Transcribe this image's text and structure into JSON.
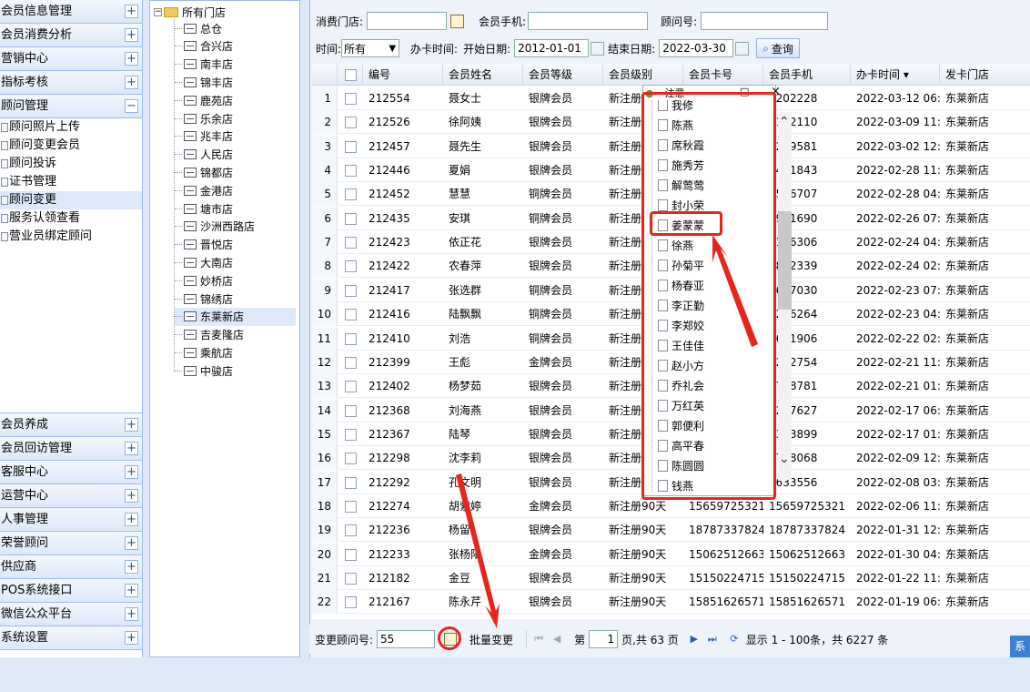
{
  "sidebar": {
    "top_groups": [
      {
        "label": "会员信息管理",
        "toggle": "+"
      },
      {
        "label": "会员消费分析",
        "toggle": "+"
      },
      {
        "label": "营销中心",
        "toggle": "+"
      },
      {
        "label": "指标考核",
        "toggle": "+"
      },
      {
        "label": "顾问管理",
        "toggle": "−"
      }
    ],
    "sub_items": [
      "顾问照片上传",
      "顾问变更会员",
      "顾问投诉",
      "证书管理",
      "顾问变更",
      "服务认领查看",
      "营业员绑定顾问"
    ],
    "selected_sub": "顾问变更",
    "bottom_groups": [
      {
        "label": "会员养成",
        "toggle": "+"
      },
      {
        "label": "会员回访管理",
        "toggle": "+"
      },
      {
        "label": "客服中心",
        "toggle": "+"
      },
      {
        "label": "运营中心",
        "toggle": "+"
      },
      {
        "label": "人事管理",
        "toggle": "+"
      },
      {
        "label": "荣誉顾问",
        "toggle": "+"
      },
      {
        "label": "供应商",
        "toggle": "+"
      },
      {
        "label": "POS系统接口",
        "toggle": "+"
      },
      {
        "label": "微信公众平台",
        "toggle": "+"
      },
      {
        "label": "系统设置",
        "toggle": "+"
      }
    ]
  },
  "store_tree": {
    "root": "所有门店",
    "stores": [
      "总仓",
      "合兴店",
      "南丰店",
      "锦丰店",
      "鹿苑店",
      "乐余店",
      "兆丰店",
      "人民店",
      "锦都店",
      "金港店",
      "塘市店",
      "沙洲西路店",
      "晋悦店",
      "大南店",
      "妙桥店",
      "锦绣店",
      "东莱新店",
      "吉麦隆店",
      "乘航店",
      "中骏店"
    ],
    "selected": "东莱新店"
  },
  "filters": {
    "store_label": "消费门店:",
    "phone_label": "会员手机:",
    "advisor_label": "顾问号:",
    "time_label": "时间:",
    "time_value": "所有",
    "card_time_label": "办卡时间:",
    "start_label": "开始日期:",
    "start_value": "2012-01-01",
    "end_label": "结束日期:",
    "end_value": "2022-03-30",
    "query_button": "查询"
  },
  "grid": {
    "columns": [
      "",
      "编号",
      "会员姓名",
      "会员等级",
      "会员级别",
      "会员卡号",
      "会员手机",
      "办卡时间 ▾",
      "发卡门店"
    ],
    "rows": [
      [
        "1",
        "212554",
        "聂女士",
        "银牌会员",
        "新注册",
        "",
        "0202228",
        "2022-03-12 06:59",
        "东莱新店"
      ],
      [
        "2",
        "212526",
        "徐阿姨",
        "银牌会员",
        "新注册",
        "",
        "5172110",
        "2022-03-09 11:08",
        "东莱新店"
      ],
      [
        "3",
        "212457",
        "聂先生",
        "银牌会员",
        "新注册",
        "",
        "2289581",
        "2022-03-02 12:45",
        "东莱新店"
      ],
      [
        "4",
        "212446",
        "夏娟",
        "银牌会员",
        "新注册",
        "",
        "8481843",
        "2022-02-28 11:52",
        "东莱新店"
      ],
      [
        "5",
        "212452",
        "慧慧",
        "铜牌会员",
        "新注册",
        "",
        "6556707",
        "2022-02-28 04:35",
        "东莱新店"
      ],
      [
        "6",
        "212435",
        "安琪",
        "铜牌会员",
        "新注册",
        "",
        "3961690",
        "2022-02-26 07:25",
        "东莱新店"
      ],
      [
        "7",
        "212423",
        "依正花",
        "银牌会员",
        "新注册",
        "",
        "5116306",
        "2022-02-24 04:02",
        "东莱新店"
      ],
      [
        "8",
        "212422",
        "农春萍",
        "银牌会员",
        "新注册",
        "",
        "2862339",
        "2022-02-24 02:45",
        "东莱新店"
      ],
      [
        "9",
        "212417",
        "张选群",
        "铜牌会员",
        "新注册",
        "",
        "0667030",
        "2022-02-23 07:28",
        "东莱新店"
      ],
      [
        "10",
        "212416",
        "陆飘飘",
        "铜牌会员",
        "新注册",
        "",
        "6226264",
        "2022-02-23 04:49",
        "东莱新店"
      ],
      [
        "11",
        "212410",
        "刘浩",
        "铜牌会员",
        "新注册",
        "",
        "5691906",
        "2022-02-22 02:07",
        "东莱新店"
      ],
      [
        "12",
        "212399",
        "王彪",
        "金牌会员",
        "新注册",
        "",
        "0232754",
        "2022-02-21 11:18",
        "东莱新店"
      ],
      [
        "13",
        "212402",
        "杨梦茹",
        "银牌会员",
        "新注册",
        "",
        "7758781",
        "2022-02-21 01:45",
        "东莱新店"
      ],
      [
        "14",
        "212368",
        "刘海燕",
        "银牌会员",
        "新注册",
        "",
        "1247627",
        "2022-02-17 06:57",
        "东莱新店"
      ],
      [
        "15",
        "212367",
        "陆琴",
        "银牌会员",
        "新注册",
        "",
        "2363899",
        "2022-02-17 01:09",
        "东莱新店"
      ],
      [
        "16",
        "212298",
        "沈李莉",
        "银牌会员",
        "新注册",
        "",
        "1718068",
        "2022-02-09 12:55",
        "东莱新店"
      ],
      [
        "17",
        "212292",
        "孔文明",
        "银牌会员",
        "新注册",
        "",
        "1633556",
        "2022-02-08 03:42",
        "东莱新店"
      ],
      [
        "18",
        "212274",
        "胡紫婷",
        "金牌会员",
        "新注册90天",
        "15659725321",
        "15659725321",
        "2022-02-06 11:46",
        "东莱新店"
      ],
      [
        "19",
        "212236",
        "杨留",
        "银牌会员",
        "新注册90天",
        "18787337824",
        "18787337824",
        "2022-01-31 12:56",
        "东莱新店"
      ],
      [
        "20",
        "212233",
        "张杨阳",
        "金牌会员",
        "新注册90天",
        "15062512663",
        "15062512663",
        "2022-01-30 04:10",
        "东莱新店"
      ],
      [
        "21",
        "212182",
        "金豆",
        "银牌会员",
        "新注册90天",
        "15150224715",
        "15150224715",
        "2022-01-22 11:40",
        "东莱新店"
      ],
      [
        "22",
        "212167",
        "陈永芹",
        "银牌会员",
        "新注册90天",
        "15851626571",
        "15851626571",
        "2022-01-19 06:41",
        "东莱新店"
      ]
    ]
  },
  "bottom_bar": {
    "change_label": "变更顾问号:",
    "change_value": "55",
    "batch_label": "批量变更",
    "page_prefix": "第",
    "page_value": "1",
    "page_suffix": "页,共 63 页",
    "display_info": "显示 1 - 100条，共 6227 条",
    "corner_text": "系"
  },
  "popup": {
    "title": "注意",
    "minimize": "□",
    "close": "×",
    "items": [
      "我修",
      "陈燕",
      "席秋霞",
      "施秀芳",
      "解莺莺",
      "封小荣",
      "姜蒙蒙",
      "徐燕",
      "孙菊平",
      "杨春亚",
      "李正勤",
      "李郑姣",
      "王佳佳",
      "赵小方",
      "乔礼会",
      "万红英",
      "郭便利",
      "高平春",
      "陈圆圆",
      "钱燕"
    ],
    "highlighted": "姜蒙蒙"
  },
  "colors": {
    "accent_red": "#e8251d",
    "header_blue": "#99bbe8"
  }
}
